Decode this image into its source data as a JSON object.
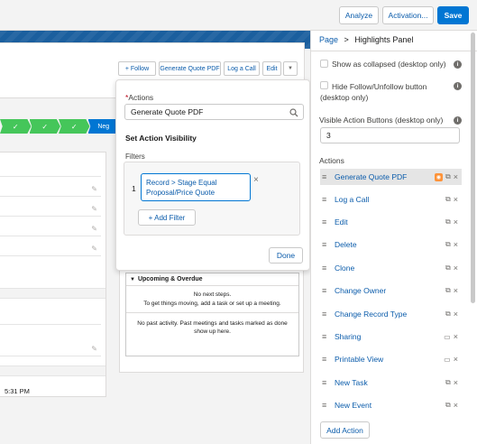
{
  "toolbar": {
    "analyze": "Analyze",
    "activation": "Activation...",
    "save": "Save"
  },
  "record": {
    "actions": [
      "+ Follow",
      "Generate Quote PDF",
      "Log a Call",
      "Edit"
    ],
    "path_next": "Neg",
    "timestamp": "5:31 PM"
  },
  "activity": {
    "header": "Upcoming & Overdue",
    "no_steps": "No next steps.",
    "no_steps_hint": "To get things moving, add a task or set up a meeting.",
    "no_past": "No past activity. Past meetings and tasks marked as done show up here."
  },
  "popover": {
    "actions_label": "Actions",
    "actions_value": "Generate Quote PDF",
    "visibility_title": "Set Action Visibility",
    "filters_label": "Filters",
    "filter_number": "1",
    "filter_text": "Record > Stage Equal Proposal/Price Quote",
    "add_filter": "+ Add Filter",
    "done": "Done"
  },
  "panel": {
    "breadcrumb_page": "Page",
    "breadcrumb_sep": ">",
    "breadcrumb_current": "Highlights Panel",
    "show_collapsed": "Show as collapsed (desktop only)",
    "hide_follow": "Hide Follow/Unfollow button (desktop only)",
    "visible_buttons_label": "Visible Action Buttons (desktop only)",
    "visible_buttons_value": "3",
    "actions_heading": "Actions",
    "add_action": "Add Action",
    "actions": [
      "Generate Quote PDF",
      "Log a Call",
      "Edit",
      "Delete",
      "Clone",
      "Change Owner",
      "Change Record Type",
      "Sharing",
      "Printable View",
      "New Task",
      "New Event"
    ]
  }
}
